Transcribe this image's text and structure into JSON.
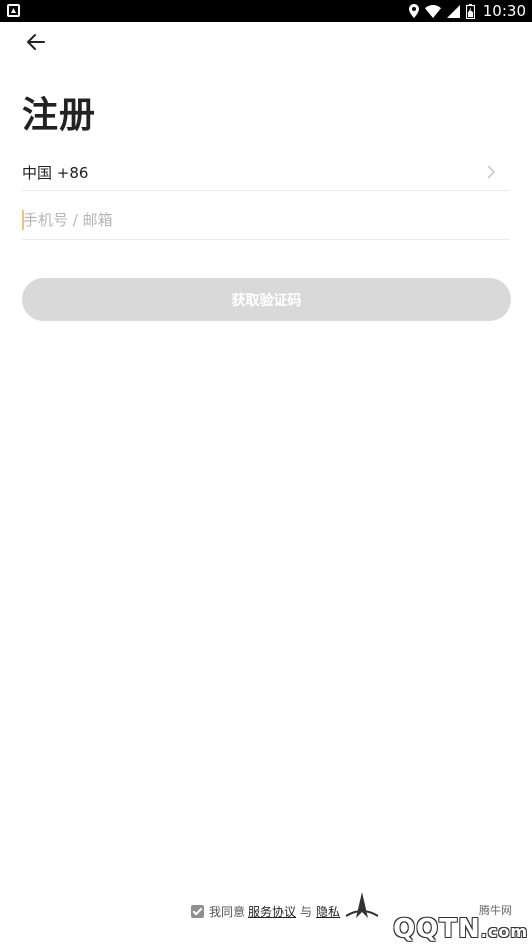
{
  "status_bar": {
    "time": "10:30",
    "icons": [
      "app-notification-icon",
      "location-icon",
      "wifi-icon",
      "signal-icon",
      "battery-icon"
    ]
  },
  "nav": {
    "back_icon": "arrow-left-icon"
  },
  "page": {
    "title": "注册"
  },
  "form": {
    "country_code_label": "中国 +86",
    "phone_placeholder": "手机号 / 邮箱",
    "phone_value": "",
    "get_code_label": "获取验证码"
  },
  "agreement": {
    "checked": true,
    "prefix": "我同意",
    "service_link": "服务协议",
    "joiner": "与",
    "privacy_link": "隐私"
  },
  "watermark": {
    "site_cn": "腾牛网",
    "brand": "QQTN",
    "suffix": ".com"
  },
  "colors": {
    "button_disabled": "#d9d9d9",
    "caret": "#f2c27b",
    "divider": "#ececec",
    "text_primary": "#222222",
    "placeholder": "#b5b5b5"
  }
}
